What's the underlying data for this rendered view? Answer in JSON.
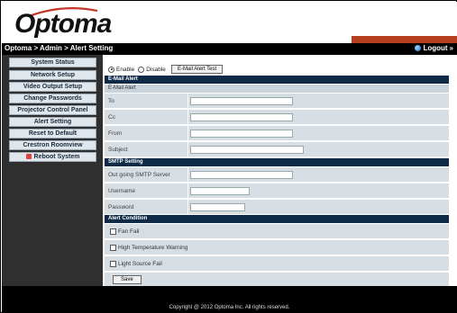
{
  "header": {
    "logo_text": "Optoma",
    "brand_red": "#b5401f"
  },
  "nav": {
    "breadcrumb": "Optoma > Admin > Alert Setting",
    "logout_label": "Logout",
    "logout_suffix": "»",
    "logout_icon": "globe-icon"
  },
  "sidebar": {
    "items": [
      {
        "label": "System Status"
      },
      {
        "label": "Network Setup"
      },
      {
        "label": "Video Output Setup"
      },
      {
        "label": "Change Passwords"
      },
      {
        "label": "Projector Control Panel"
      },
      {
        "label": "Alert Setting"
      },
      {
        "label": "Reset to Default"
      },
      {
        "label": "Crestron Roomview"
      },
      {
        "label": "Reboot System",
        "icon": "reboot-icon"
      }
    ]
  },
  "main": {
    "enable_label": "Enable",
    "disable_label": "Disable",
    "enable_selected": "Enable",
    "test_button": "E-Mail Alert Test",
    "email_section": "E-Mail Alert",
    "email_subhead": "E-Mail Alert",
    "email_fields": {
      "to": {
        "label": "To",
        "value": ""
      },
      "cc": {
        "label": "Cc",
        "value": ""
      },
      "from": {
        "label": "From",
        "value": ""
      },
      "subject": {
        "label": "Subject",
        "value": ""
      }
    },
    "smtp_section": "SMTP Setting",
    "smtp_fields": {
      "server": {
        "label": "Out going SMTP Server",
        "value": ""
      },
      "username": {
        "label": "Username",
        "value": ""
      },
      "password": {
        "label": "Password",
        "value": ""
      }
    },
    "alert_section": "Alert Condition",
    "conditions": [
      {
        "label": "Fan Fail",
        "checked": false
      },
      {
        "label": "High Temperature Warning",
        "checked": false
      },
      {
        "label": "Light Source Fail",
        "checked": false
      }
    ],
    "save_button": "Save",
    "header_color": "#0e2a47"
  },
  "footer": {
    "copyright": "Copyright @ 2012 Optoma Inc. All rights reserved."
  }
}
